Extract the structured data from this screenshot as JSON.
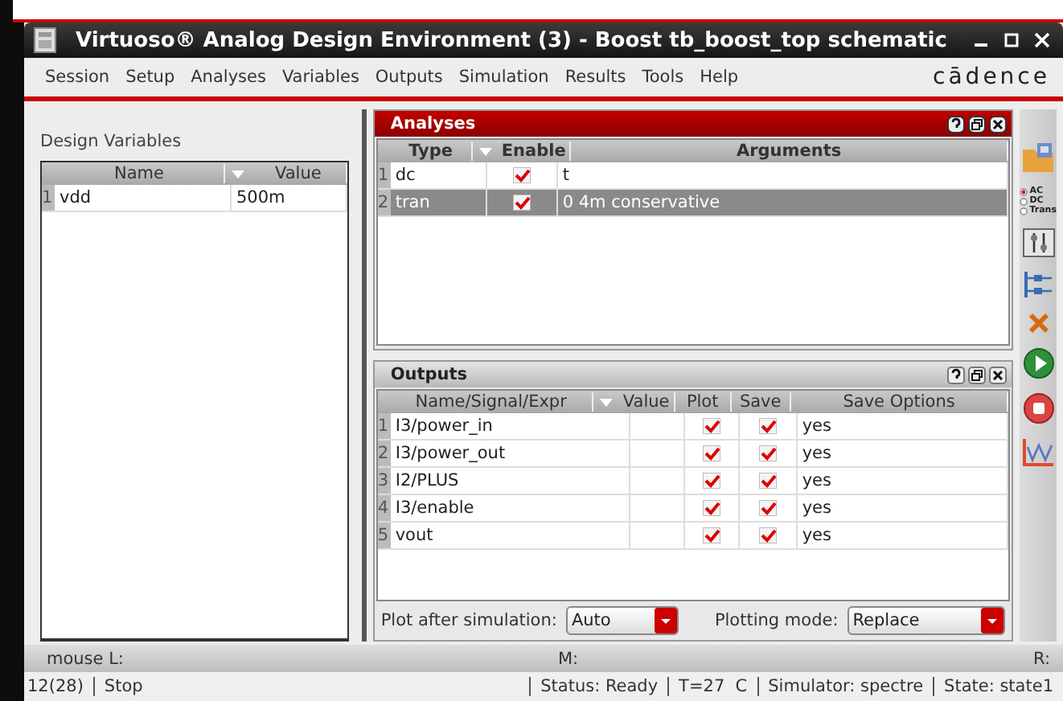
{
  "window": {
    "title": "Virtuoso® Analog Design Environment (3) - Boost tb_boost_top schematic"
  },
  "menu": [
    "Session",
    "Setup",
    "Analyses",
    "Variables",
    "Outputs",
    "Simulation",
    "Results",
    "Tools",
    "Help"
  ],
  "brand": "cādence",
  "design_variables": {
    "title": "Design Variables",
    "columns": [
      "Name",
      "Value"
    ],
    "rows": [
      {
        "index": "1",
        "name": "vdd",
        "value": "500m"
      }
    ]
  },
  "analyses": {
    "title": "Analyses",
    "columns": [
      "Type",
      "Enable",
      "Arguments"
    ],
    "rows": [
      {
        "index": "1",
        "type": "dc",
        "enabled": true,
        "arguments": "t",
        "selected": false
      },
      {
        "index": "2",
        "type": "tran",
        "enabled": true,
        "arguments": "0 4m conservative",
        "selected": true
      }
    ]
  },
  "outputs": {
    "title": "Outputs",
    "columns": [
      "Name/Signal/Expr",
      "Value",
      "Plot",
      "Save",
      "Save Options"
    ],
    "rows": [
      {
        "index": "1",
        "name": "I3/power_in",
        "plot": true,
        "save": true,
        "save_options": "yes"
      },
      {
        "index": "2",
        "name": "I3/power_out",
        "plot": true,
        "save": true,
        "save_options": "yes"
      },
      {
        "index": "3",
        "name": "I2/PLUS",
        "plot": true,
        "save": true,
        "save_options": "yes"
      },
      {
        "index": "4",
        "name": "I3/enable",
        "plot": true,
        "save": true,
        "save_options": "yes"
      },
      {
        "index": "5",
        "name": "vout",
        "plot": true,
        "save": true,
        "save_options": "yes"
      }
    ],
    "plot_after_label": "Plot after simulation:",
    "plot_after_value": "Auto",
    "plotting_mode_label": "Plotting mode:",
    "plotting_mode_value": "Replace"
  },
  "toolbar": {
    "modes": [
      {
        "label": "AC",
        "selected": true
      },
      {
        "label": "DC",
        "selected": false
      },
      {
        "label": "Trans",
        "selected": false
      }
    ]
  },
  "mouse_bar": {
    "left": "mouse L:",
    "middle": "M:",
    "right": "R:"
  },
  "status_bar": {
    "count": "12(28)",
    "command": "Stop",
    "status": "Status: Ready",
    "temperature": "T=27  C",
    "simulator": "Simulator: spectre",
    "state": "State: state1"
  }
}
